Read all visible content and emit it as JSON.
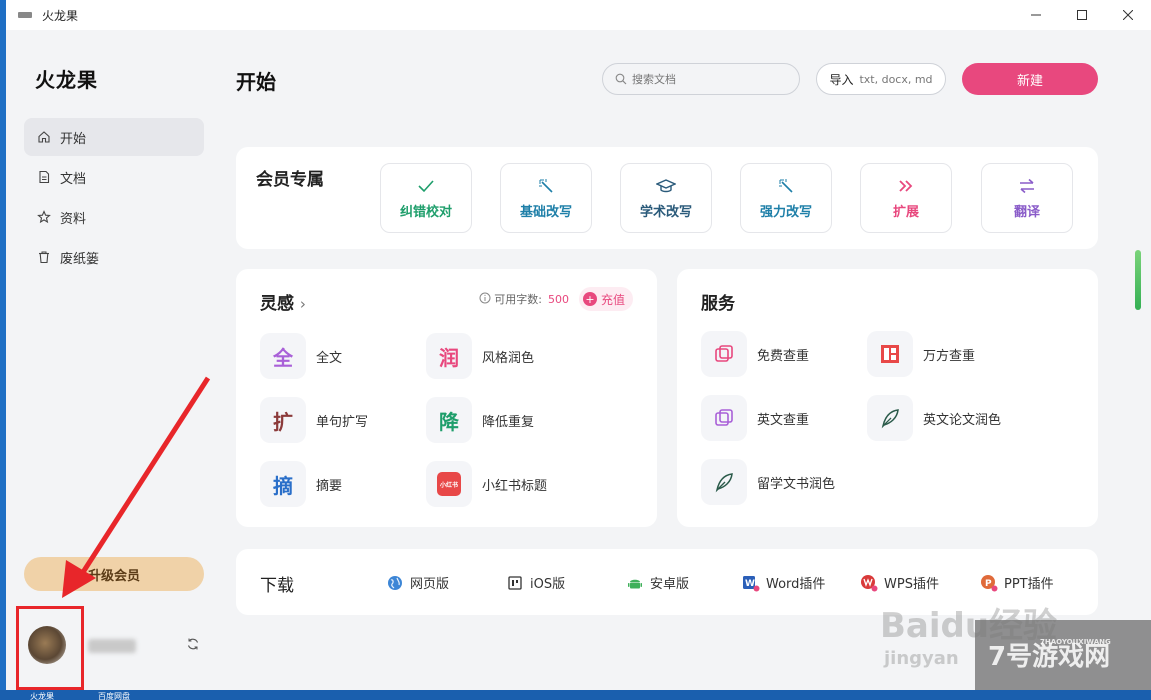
{
  "window": {
    "title": "火龙果"
  },
  "sidebar": {
    "logo": "火龙果",
    "items": [
      {
        "label": "开始",
        "icon": "home-icon",
        "active": true
      },
      {
        "label": "文档",
        "icon": "document-icon"
      },
      {
        "label": "资料",
        "icon": "star-icon"
      },
      {
        "label": "废纸篓",
        "icon": "trash-icon"
      }
    ],
    "upgrade_label": "升级会员"
  },
  "header": {
    "title": "开始",
    "search_placeholder": "搜索文档",
    "import_label": "导入",
    "import_formats": "txt, docx, md",
    "new_label": "新建"
  },
  "member": {
    "title": "会员专属",
    "tools": [
      {
        "label": "纠错校对",
        "icon": "check-icon",
        "color": "#1e9e6b"
      },
      {
        "label": "基础改写",
        "icon": "magic-wand-icon",
        "color": "#1e7fa8"
      },
      {
        "label": "学术改写",
        "icon": "graduation-cap-icon",
        "color": "#2a5a7a"
      },
      {
        "label": "强力改写",
        "icon": "magic-wand-icon",
        "color": "#1e7fa8"
      },
      {
        "label": "扩展",
        "icon": "double-chevron-icon",
        "color": "#e8487e"
      },
      {
        "label": "翻译",
        "icon": "swap-arrows-icon",
        "color": "#8a5cc9"
      }
    ]
  },
  "inspiration": {
    "title": "灵感",
    "available_label": "可用字数:",
    "available_value": "500",
    "recharge_label": "充值",
    "items": [
      {
        "glyph": "全",
        "label": "全文",
        "color": "#a960d8"
      },
      {
        "glyph": "润",
        "label": "风格润色",
        "color": "#e8487e"
      },
      {
        "glyph": "扩",
        "label": "单句扩写",
        "color": "#8b3a3a"
      },
      {
        "glyph": "降",
        "label": "降低重复",
        "color": "#1e9e6b"
      },
      {
        "glyph": "摘",
        "label": "摘要",
        "color": "#2a6fc9"
      },
      {
        "glyph": "小红书",
        "label": "小红书标题",
        "color": "#e84848"
      }
    ]
  },
  "services": {
    "title": "服务",
    "items": [
      {
        "label": "免费查重",
        "icon": "copy-check-icon",
        "color": "#e8487e"
      },
      {
        "label": "万方查重",
        "icon": "layout-grid-icon",
        "color": "#e84848"
      },
      {
        "label": "英文查重",
        "icon": "copy-check-icon",
        "color": "#a960d8"
      },
      {
        "label": "英文论文润色",
        "icon": "feather-pen-icon",
        "color": "#2a5a4a"
      },
      {
        "label": "留学文书润色",
        "icon": "feather-pen-icon",
        "color": "#2a5a4a"
      }
    ]
  },
  "download": {
    "title": "下载",
    "items": [
      {
        "label": "网页版",
        "icon": "globe-icon"
      },
      {
        "label": "iOS版",
        "icon": "ios-icon"
      },
      {
        "label": "安卓版",
        "icon": "android-icon"
      },
      {
        "label": "Word插件",
        "icon": "word-icon"
      },
      {
        "label": "WPS插件",
        "icon": "wps-icon"
      },
      {
        "label": "PPT插件",
        "icon": "ppt-icon"
      }
    ]
  },
  "taskbar": {
    "items": [
      "火龙果",
      "百度网盘"
    ]
  },
  "watermarks": {
    "baidu": "Baidu经验",
    "jingyan": "jingyan",
    "site": "7号游戏网",
    "site_pinyin": "7HAOYOUXIWANG"
  }
}
